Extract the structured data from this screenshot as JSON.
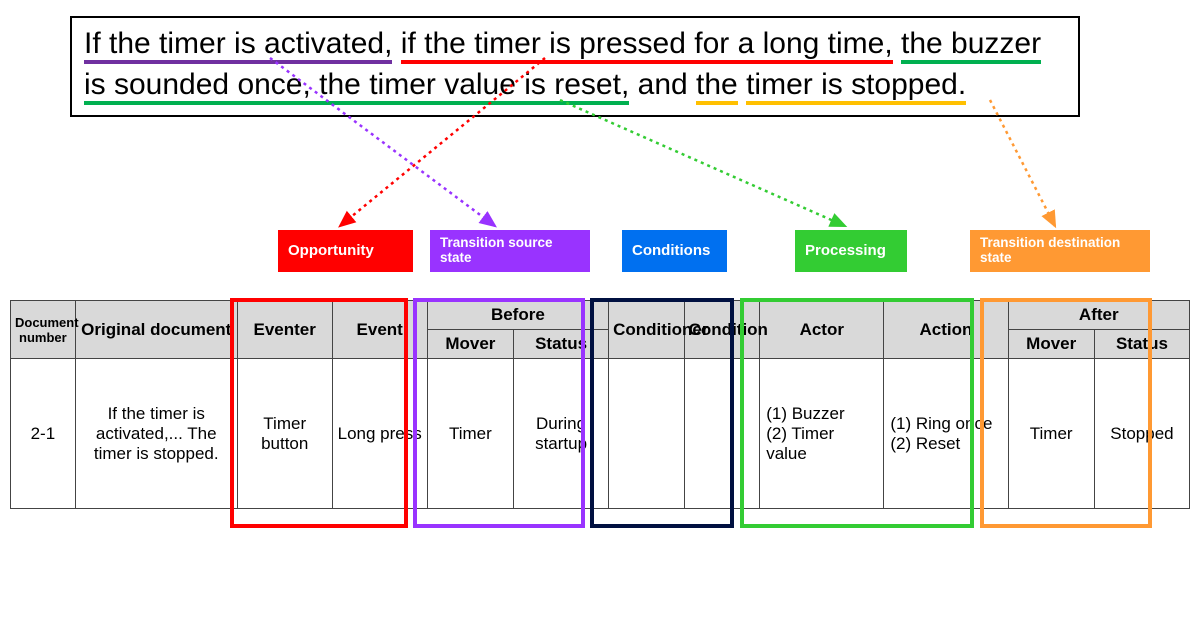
{
  "sentence": {
    "seg_purple": "If the timer is activated,",
    "seg_red": "if the timer is pressed for a long time,",
    "seg_green": "the buzzer is sounded once, the timer value is reset,",
    "seg_plain": " and ",
    "seg_orange1": "the",
    "seg_orange2": "timer is stopped."
  },
  "tags": {
    "opportunity": "Opportunity",
    "tss": "Transition source state",
    "conditions": "Conditions",
    "processing": "Processing",
    "tds": "Transition destination state"
  },
  "table": {
    "headers": {
      "doc_no": "Document number",
      "orig": "Original document",
      "eventer": "Eventer",
      "event": "Event",
      "before": "Before",
      "before_mover": "Mover",
      "before_status": "Status",
      "conditioner": "Conditioner",
      "condition": "Condition",
      "actor": "Actor",
      "action": "Action",
      "after": "After",
      "after_mover": "Mover",
      "after_status": "Status"
    },
    "row": {
      "doc_no": "2-1",
      "orig": "If the timer is activated,... The timer is stopped.",
      "eventer": "Timer button",
      "event": "Long press",
      "before_mover": "Timer",
      "before_status": "During startup",
      "conditioner": "",
      "condition": "",
      "actor": "(1) Buzzer\n(2) Timer value",
      "action": "(1)  Ring once\n(2)  Reset",
      "after_mover": "Timer",
      "after_status": "Stopped"
    }
  },
  "colors": {
    "purple": "#7030A0",
    "red": "#FF0000",
    "green": "#00B050",
    "orange": "#FFC000",
    "blue": "#0070F0",
    "darknavy": "#001040"
  }
}
